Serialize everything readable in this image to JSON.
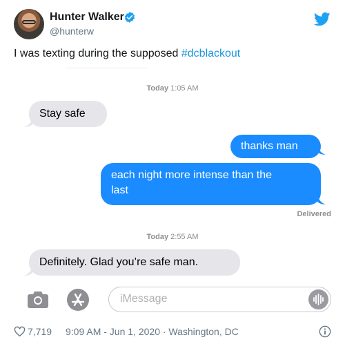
{
  "author": {
    "name": "Hunter Walker",
    "handle": "@hunterw"
  },
  "tweet": {
    "text_prefix": "I was texting during the supposed ",
    "hashtag": "#dcblackout"
  },
  "messages": {
    "timestamp1_day": "Today",
    "timestamp1_time": "1:05 AM",
    "incoming1": "Stay safe",
    "outgoing1": "thanks man",
    "outgoing2_line1": "each night more intense than the",
    "outgoing2_line2": "last",
    "delivered": "Delivered",
    "timestamp2_day": "Today",
    "timestamp2_time": "2:55 AM",
    "incoming2": "Definitely. Glad you’re safe man."
  },
  "compose": {
    "placeholder": "iMessage"
  },
  "footer": {
    "likes": "7,719",
    "time": "9:09 AM - Jun 1, 2020 · Washington, DC"
  },
  "colors": {
    "twitter_blue": "#1da1f2",
    "imessage_blue": "#1a8cff",
    "incoming_gray": "#e5e5ea",
    "hashtag": "#1b95e0"
  },
  "icons": [
    "verified-icon",
    "twitter-bird-icon",
    "camera-icon",
    "app-store-icon",
    "audio-waveform-icon",
    "heart-icon",
    "info-icon"
  ]
}
